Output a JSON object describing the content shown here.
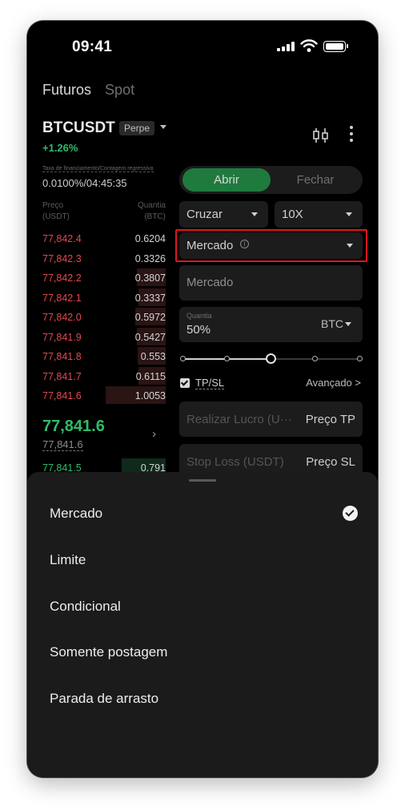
{
  "status_bar": {
    "time": "09:41"
  },
  "market_tabs": [
    "Futuros",
    "Spot"
  ],
  "ticker": {
    "symbol": "BTCUSDT",
    "contract_type": "Perpe",
    "change": "+1.26%"
  },
  "funding": {
    "label": "Taxa de financiamento/Contagem regressiva",
    "value": "0.0100%/04:45:35"
  },
  "orderbook": {
    "price_header": "Preço",
    "price_unit": "(USDT)",
    "qty_header": "Quantia",
    "qty_unit": "(BTC)",
    "asks": [
      {
        "price": "77,842.4",
        "qty": "0.6204",
        "depth": 0.0
      },
      {
        "price": "77,842.3",
        "qty": "0.3326",
        "depth": 0.0
      },
      {
        "price": "77,842.2",
        "qty": "0.3807",
        "depth": 0.48
      },
      {
        "price": "77,842.1",
        "qty": "0.3337",
        "depth": 0.45
      },
      {
        "price": "77,842.0",
        "qty": "0.5972",
        "depth": 0.5
      },
      {
        "price": "77,841.9",
        "qty": "0.5427",
        "depth": 0.48
      },
      {
        "price": "77,841.8",
        "qty": "0.553",
        "depth": 0.47
      },
      {
        "price": "77,841.7",
        "qty": "0.6115",
        "depth": 0.45
      },
      {
        "price": "77,841.6",
        "qty": "1.0053",
        "depth": 1.0
      }
    ],
    "last_price": "77,841.6",
    "mark_price": "77,841.6",
    "bids": [
      {
        "price": "77,841.5",
        "qty": "0.791",
        "depth": 1.0
      }
    ]
  },
  "order_form": {
    "side_tabs": {
      "open": "Abrir",
      "close": "Fechar"
    },
    "margin_mode": "Cruzar",
    "leverage": "10X",
    "order_type": "Mercado",
    "price_display": "Mercado",
    "quantity": {
      "label": "Quantia",
      "value": "50%",
      "unit": "BTC"
    },
    "slider": {
      "percent": 50,
      "stops": [
        0,
        25,
        50,
        75,
        100
      ]
    },
    "tpsl": {
      "label": "TP/SL",
      "checked": true,
      "advanced": "Avançado >"
    },
    "take_profit": {
      "placeholder": "Realizar Lucro (U···",
      "suffix": "Preço TP"
    },
    "stop_loss": {
      "placeholder": "Stop Loss (USDT)",
      "suffix": "Preço SL"
    }
  },
  "order_type_sheet": {
    "options": [
      "Mercado",
      "Limite",
      "Condicional",
      "Somente postagem",
      "Parada de arrasto"
    ],
    "selected": "Mercado"
  },
  "colors": {
    "buy": "#2ebd6b",
    "sell": "#e04850",
    "open_tab": "#1f7a3e",
    "highlight": "#e0161e"
  }
}
